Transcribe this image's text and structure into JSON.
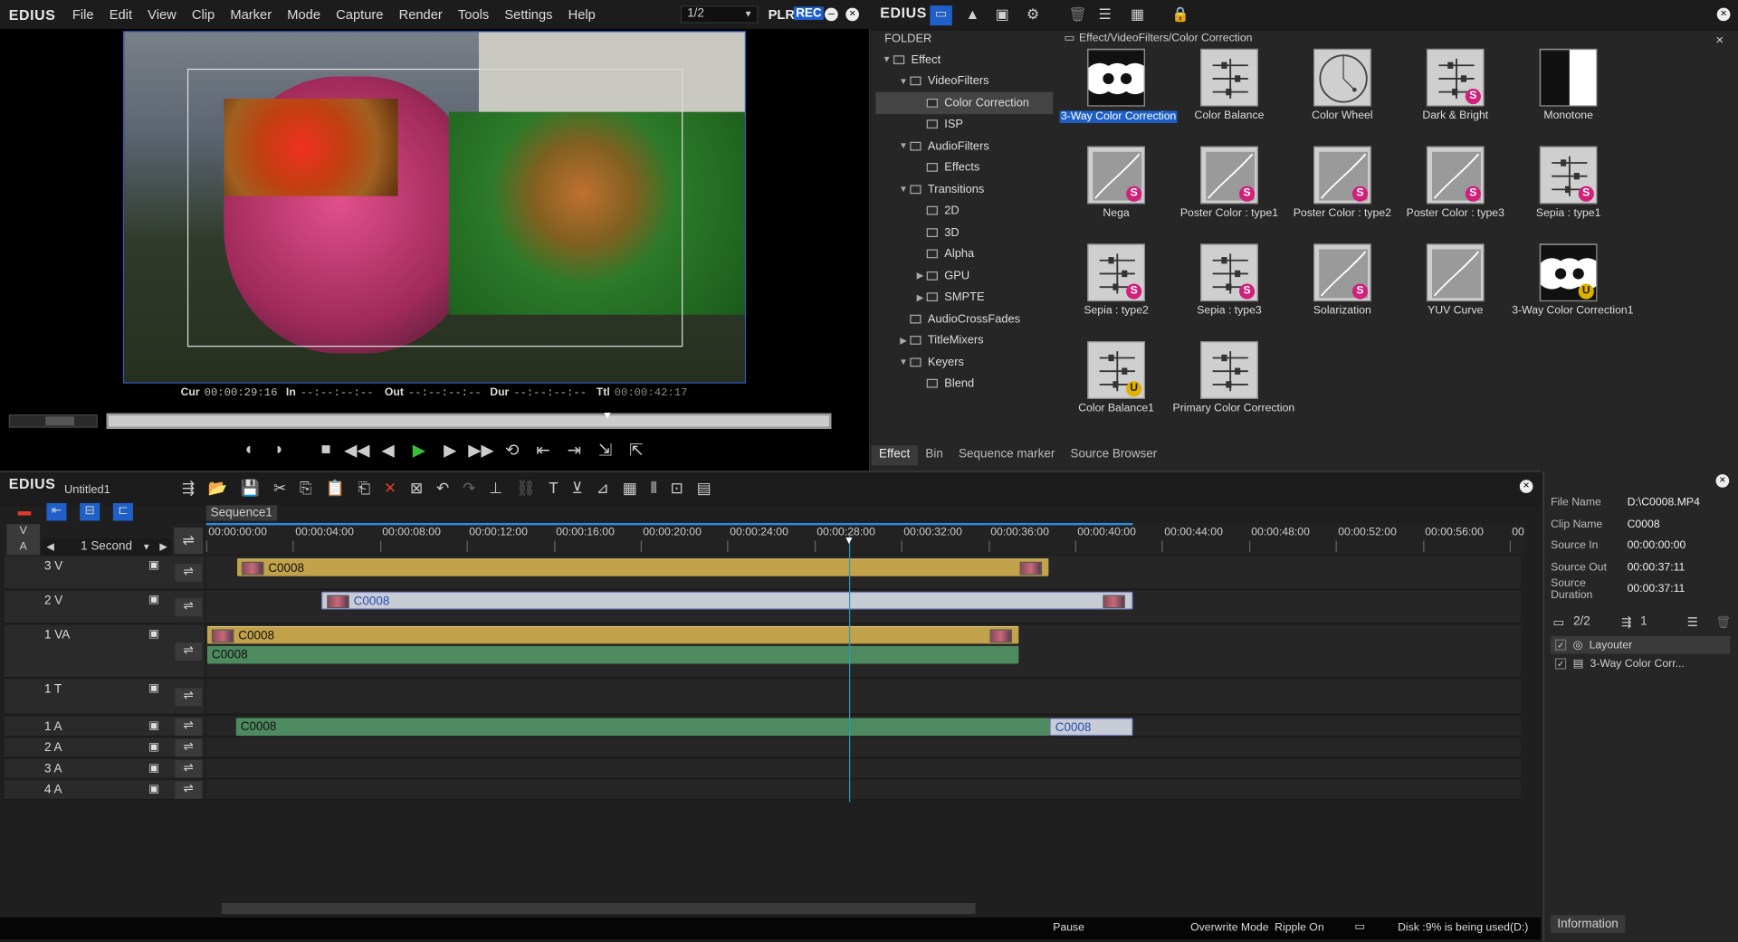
{
  "player": {
    "logo": "EDIUS",
    "menu": [
      "File",
      "Edit",
      "View",
      "Clip",
      "Marker",
      "Mode",
      "Capture",
      "Render",
      "Tools",
      "Settings",
      "Help"
    ],
    "page": "1/2",
    "plr": "PLR",
    "rec": "REC",
    "timecodes": {
      "cur_label": "Cur",
      "cur": "00:00:29:16",
      "in_label": "In",
      "in": "--:--:--:--",
      "out_label": "Out",
      "out": "--:--:--:--",
      "dur_label": "Dur",
      "dur": "--:--:--:--",
      "ttl_label": "Ttl",
      "ttl": "00:00:42:17"
    }
  },
  "effect": {
    "logo": "EDIUS",
    "folder_label": "FOLDER",
    "path": "Effect/VideoFilters/Color Correction",
    "tree": [
      {
        "label": "Effect",
        "depth": 0,
        "arrow": "▼"
      },
      {
        "label": "VideoFilters",
        "depth": 1,
        "arrow": "▼"
      },
      {
        "label": "Color Correction",
        "depth": 2,
        "arrow": "",
        "selected": true
      },
      {
        "label": "ISP",
        "depth": 2,
        "arrow": ""
      },
      {
        "label": "AudioFilters",
        "depth": 1,
        "arrow": "▼"
      },
      {
        "label": "Effects",
        "depth": 2,
        "arrow": ""
      },
      {
        "label": "Transitions",
        "depth": 1,
        "arrow": "▼"
      },
      {
        "label": "2D",
        "depth": 2,
        "arrow": ""
      },
      {
        "label": "3D",
        "depth": 2,
        "arrow": ""
      },
      {
        "label": "Alpha",
        "depth": 2,
        "arrow": ""
      },
      {
        "label": "GPU",
        "depth": 2,
        "arrow": "▶"
      },
      {
        "label": "SMPTE",
        "depth": 2,
        "arrow": "▶"
      },
      {
        "label": "AudioCrossFades",
        "depth": 1,
        "arrow": ""
      },
      {
        "label": "TitleMixers",
        "depth": 1,
        "arrow": "▶"
      },
      {
        "label": "Keyers",
        "depth": 1,
        "arrow": "▼"
      },
      {
        "label": "Blend",
        "depth": 2,
        "arrow": ""
      }
    ],
    "items": [
      {
        "label": "3-Way Color Correction",
        "icon": "circles-icon",
        "badge": "",
        "selected": true
      },
      {
        "label": "Color Balance",
        "icon": "sliders-icon",
        "badge": ""
      },
      {
        "label": "Color Wheel",
        "icon": "wheel-icon",
        "badge": ""
      },
      {
        "label": "Dark & Bright",
        "icon": "sliders-icon",
        "badge": "S"
      },
      {
        "label": "Monotone",
        "icon": "monotone-icon",
        "badge": ""
      },
      {
        "label": "Nega",
        "icon": "curve-icon",
        "badge": "S"
      },
      {
        "label": "Poster Color : type1",
        "icon": "curve-icon",
        "badge": "S"
      },
      {
        "label": "Poster Color : type2",
        "icon": "curve-icon",
        "badge": "S"
      },
      {
        "label": "Poster Color : type3",
        "icon": "curve-icon",
        "badge": "S"
      },
      {
        "label": "Sepia : type1",
        "icon": "sliders-icon",
        "badge": "S"
      },
      {
        "label": "Sepia : type2",
        "icon": "sliders-icon",
        "badge": "S"
      },
      {
        "label": "Sepia : type3",
        "icon": "sliders-icon",
        "badge": "S"
      },
      {
        "label": "Solarization",
        "icon": "curve-icon",
        "badge": "S"
      },
      {
        "label": "YUV Curve",
        "icon": "curve-icon",
        "badge": ""
      },
      {
        "label": "3-Way Color Correction1",
        "icon": "circles-icon",
        "badge": "U"
      },
      {
        "label": "Color Balance1",
        "icon": "sliders-icon",
        "badge": "U"
      },
      {
        "label": "Primary Color Correction",
        "icon": "sliders-icon",
        "badge": ""
      }
    ],
    "tabs": [
      "Effect",
      "Bin",
      "Sequence marker",
      "Source Browser"
    ]
  },
  "timeline": {
    "logo": "EDIUS",
    "project": "Untitled1",
    "sequence_tab": "Sequence1",
    "scale": "1 Second",
    "v_label": "V",
    "a_label": "A",
    "ruler": [
      "00:00:00:00",
      "00:00:04:00",
      "00:00:08:00",
      "00:00:12:00",
      "00:00:16:00",
      "00:00:20:00",
      "00:00:24:00",
      "00:00:28:00",
      "00:00:32:00",
      "00:00:36:00",
      "00:00:40:00",
      "00:00:44:00",
      "00:00:48:00",
      "00:00:52:00",
      "00:00:56:00",
      "00"
    ],
    "tracks": {
      "t3v": "3 V",
      "t2v": "2 V",
      "t1va": "1 VA",
      "t1t": "1 T",
      "t1a": "1 A",
      "t2a": "2 A",
      "t3a": "3 A",
      "t4a": "4 A"
    },
    "clip_name": "C0008",
    "status": {
      "pause": "Pause",
      "mode": "Overwrite Mode",
      "ripple": "Ripple On",
      "disk": "Disk :9% is being used(D:)"
    }
  },
  "info": {
    "rows": [
      {
        "k": "File Name",
        "v": "D:\\C0008.MP4"
      },
      {
        "k": "Clip Name",
        "v": "C0008"
      },
      {
        "k": "Source In",
        "v": "00:00:00:00"
      },
      {
        "k": "Source Out",
        "v": "00:00:37:11"
      },
      {
        "k": "Source Duration",
        "v": "00:00:37:11"
      }
    ],
    "page": "2/2",
    "count": "1",
    "layers": [
      "Layouter",
      "3-Way Color Corr..."
    ],
    "tab": "Information"
  }
}
